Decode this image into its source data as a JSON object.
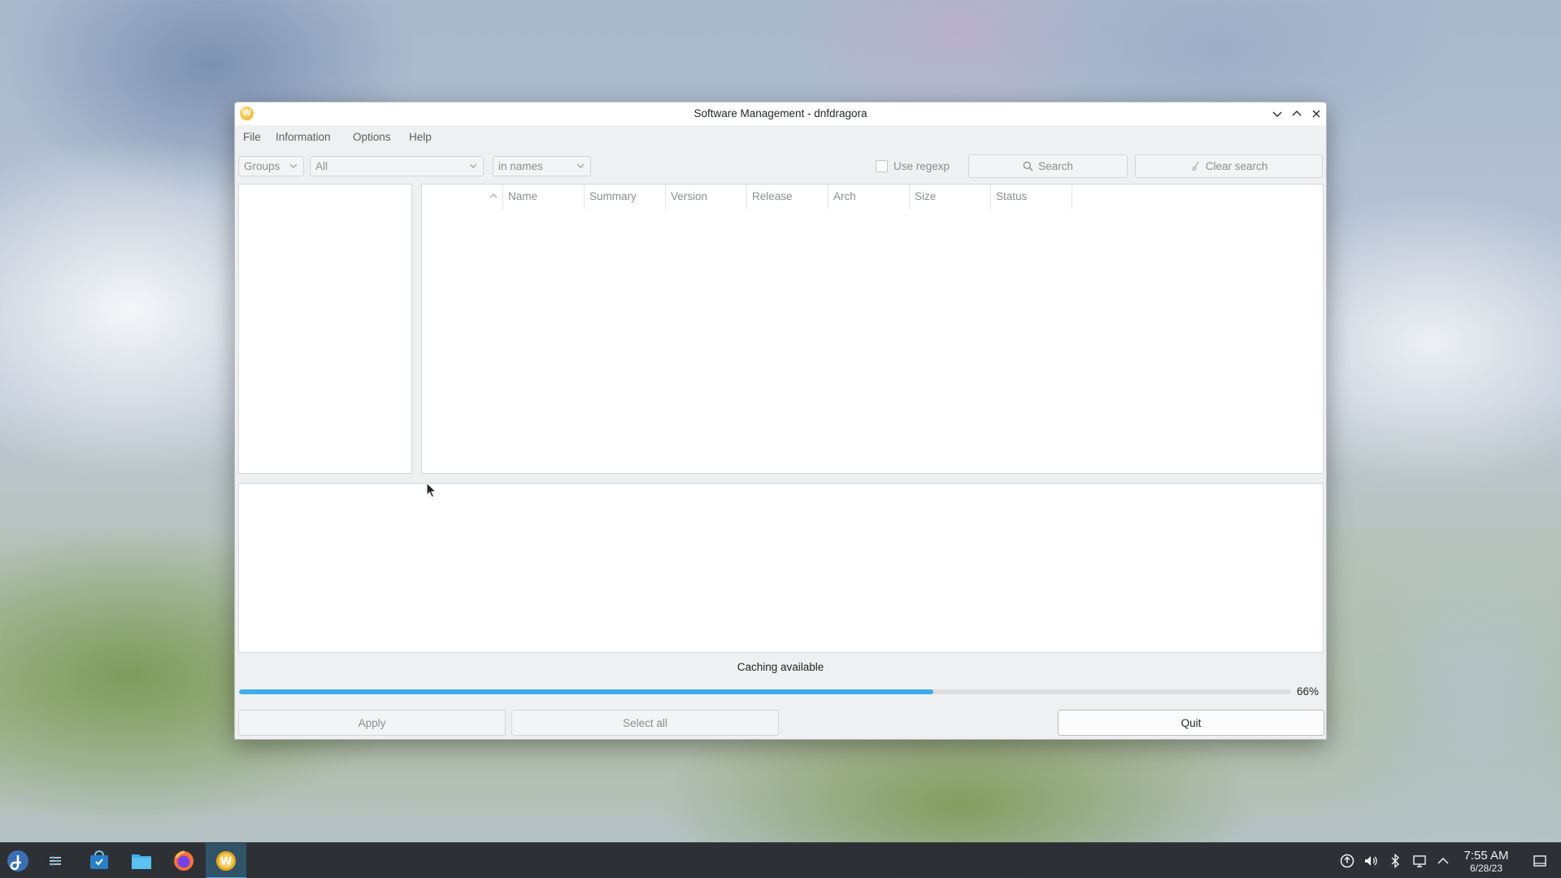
{
  "window": {
    "title": "Software Management - dnfdragora",
    "app_icon_letter": "W"
  },
  "menu": {
    "items": [
      "File",
      "Information",
      "Options",
      "Help"
    ]
  },
  "filters": {
    "view_combo": "Groups",
    "filter_combo": "All",
    "search_scope_combo": "in names",
    "use_regexp_label": "Use regexp",
    "use_regexp_checked": false,
    "search_button": "Search",
    "clear_search_button": "Clear search"
  },
  "package_table": {
    "columns": [
      "Name",
      "Summary",
      "Version",
      "Release",
      "Arch",
      "Size",
      "Status"
    ],
    "rows": []
  },
  "group_list": {
    "items": []
  },
  "status": {
    "message": "Caching available",
    "progress_percent": 66,
    "progress_label": "66%"
  },
  "actions": {
    "apply": "Apply",
    "select_all": "Select all",
    "quit": "Quit"
  },
  "taskbar": {
    "apps": [
      "fedora-start-icon",
      "settings-icon",
      "discover-store-icon",
      "file-manager-icon",
      "firefox-icon",
      "dnfdragora-icon"
    ],
    "tray": [
      "update-icon",
      "volume-icon",
      "bluetooth-icon",
      "network-icon",
      "expand-tray-icon",
      "show-desktop-icon"
    ],
    "time": "7:55 AM",
    "date": "6/28/23"
  },
  "colors": {
    "accent": "#3daee9",
    "window_bg": "#eff0f1",
    "taskbar_bg": "#282b30"
  }
}
